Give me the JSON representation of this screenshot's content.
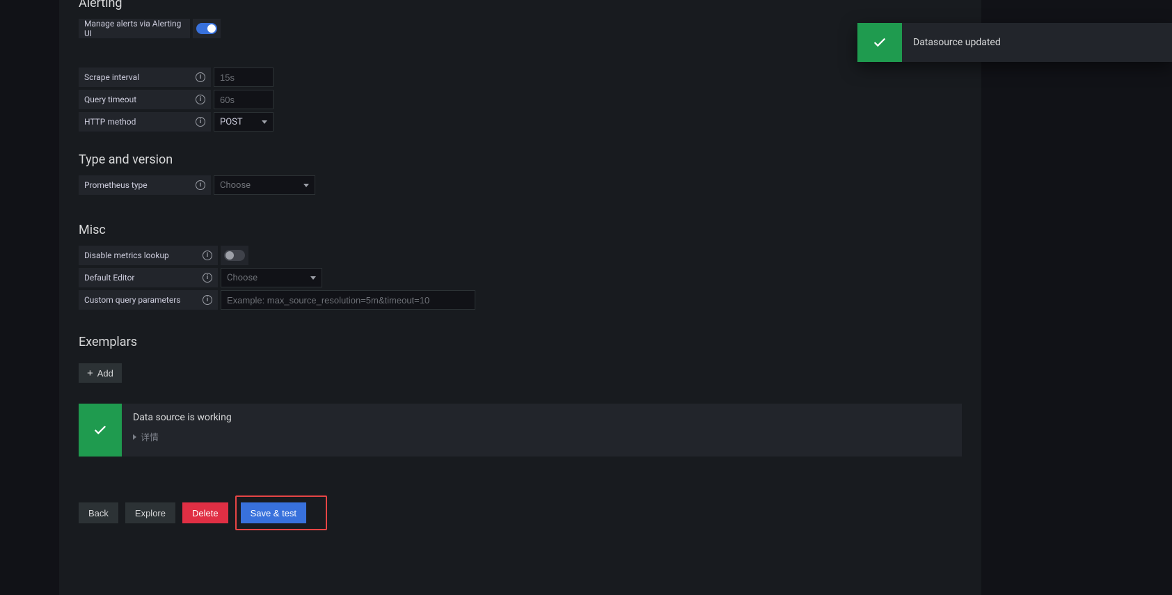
{
  "sections": {
    "alerting": {
      "title": "Alerting",
      "manage_alerts_label": "Manage alerts via Alerting UI",
      "manage_alerts_on": true
    },
    "intervals": {
      "scrape_label": "Scrape interval",
      "scrape_placeholder": "15s",
      "timeout_label": "Query timeout",
      "timeout_placeholder": "60s",
      "http_label": "HTTP method",
      "http_value": "POST"
    },
    "typeversion": {
      "title": "Type and version",
      "ptype_label": "Prometheus type",
      "ptype_placeholder": "Choose"
    },
    "misc": {
      "title": "Misc",
      "disable_lookup_label": "Disable metrics lookup",
      "disable_lookup_on": false,
      "default_editor_label": "Default Editor",
      "default_editor_placeholder": "Choose",
      "custom_query_label": "Custom query parameters",
      "custom_query_placeholder": "Example: max_source_resolution=5m&timeout=10"
    },
    "exemplars": {
      "title": "Exemplars",
      "add_label": "Add"
    }
  },
  "status": {
    "message": "Data source is working",
    "details_label": "详情"
  },
  "buttons": {
    "back": "Back",
    "explore": "Explore",
    "delete": "Delete",
    "save_test": "Save & test"
  },
  "toast": {
    "message": "Datasource updated"
  }
}
